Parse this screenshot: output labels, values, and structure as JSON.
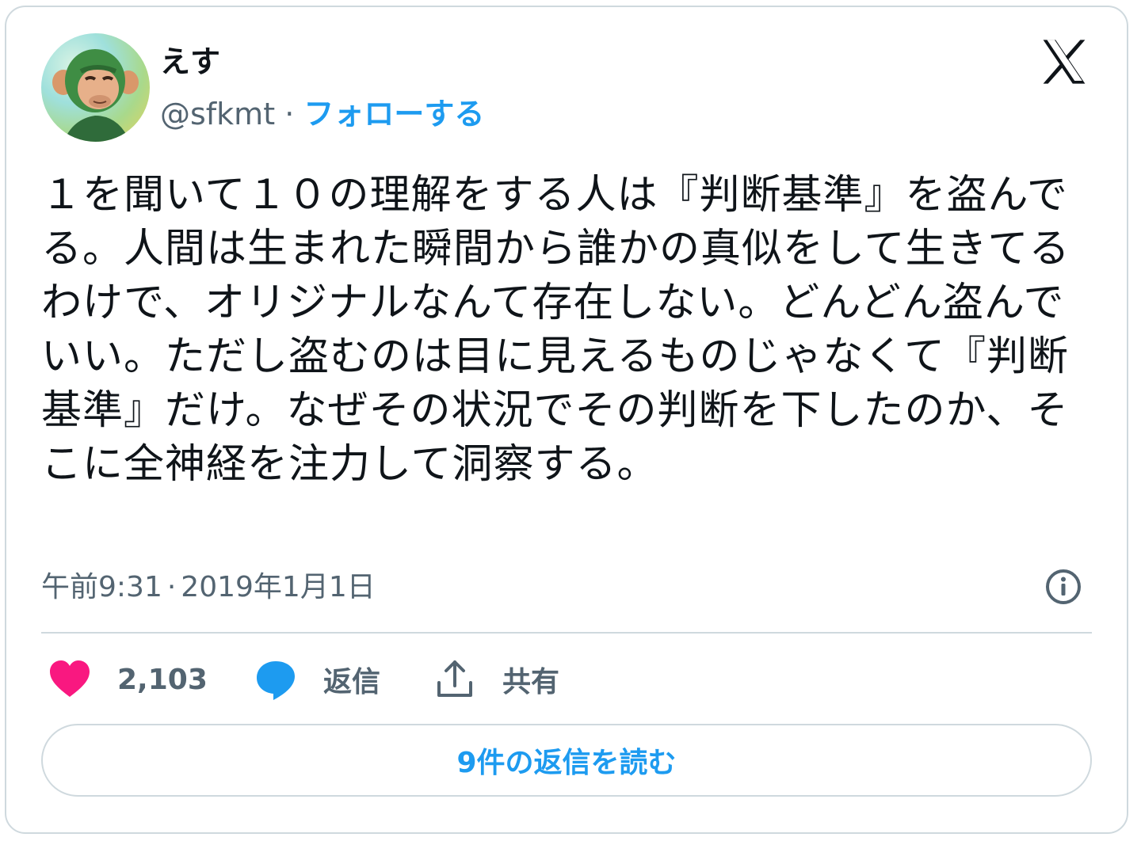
{
  "author": {
    "display_name": "えす",
    "handle": "@sfkmt",
    "separator": "·",
    "follow_label": "フォローする"
  },
  "tweet": {
    "text": "１を聞いて１０の理解をする人は『判断基準』を盗んでる。人間は生まれた瞬間から誰かの真似をして生きてるわけで、オリジナルなんて存在しない。どんどん盗んでいい。ただし盗むのは目に見えるものじゃなくて『判断基準』だけ。なぜその状況でその判断を下したのか、そこに全神経を注力して洞察する。",
    "time": "午前9:31",
    "meta_separator": "·",
    "date": "2019年1月1日"
  },
  "actions": {
    "like_count": "2,103",
    "reply_label": "返信",
    "share_label": "共有"
  },
  "read_replies_label": "9件の返信を読む",
  "icons": {
    "logo": "x-logo-icon",
    "info": "info-icon",
    "like": "heart-icon",
    "reply": "speech-bubble-icon",
    "share": "share-upload-icon"
  },
  "colors": {
    "accent": "#1d9bf0",
    "like": "#f91880",
    "secondary_text": "#536471",
    "border": "#cfd9de"
  }
}
